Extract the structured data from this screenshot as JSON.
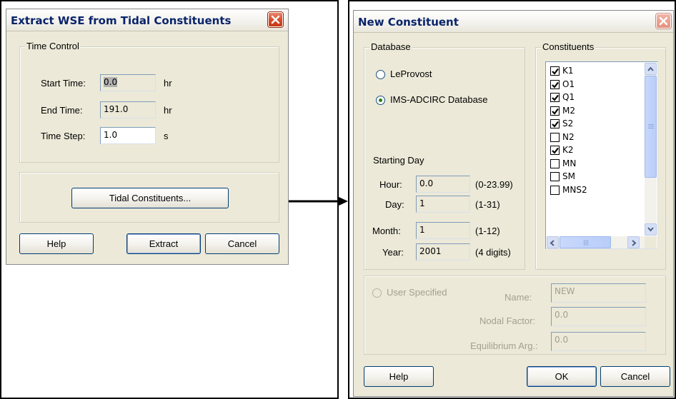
{
  "extract_dialog": {
    "title": "Extract WSE from Tidal Constituents",
    "time_control_legend": "Time Control",
    "start_time_label": "Start Time:",
    "start_time_value": "0.0",
    "start_time_unit": "hr",
    "end_time_label": "End Time:",
    "end_time_value": "191.0",
    "end_time_unit": "hr",
    "time_step_label": "Time Step:",
    "time_step_value": "1.0",
    "time_step_unit": "s",
    "tidal_constituents_button": "Tidal Constituents...",
    "help_button": "Help",
    "extract_button": "Extract",
    "cancel_button": "Cancel"
  },
  "constituent_dialog": {
    "title": "New Constituent",
    "database_legend": "Database",
    "radio_leprovost": "LeProvost",
    "radio_ims": "IMS-ADCIRC Database",
    "selected_database": "IMS-ADCIRC Database",
    "starting_day_label": "Starting Day",
    "hour_label": "Hour:",
    "hour_value": "0.0",
    "hour_range": "(0-23.99)",
    "day_label": "Day:",
    "day_value": "1",
    "day_range": "(1-31)",
    "month_label": "Month:",
    "month_value": "1",
    "month_range": "(1-12)",
    "year_label": "Year:",
    "year_value": "2001",
    "year_range": "(4 digits)",
    "constituents_legend": "Constituents",
    "constituents": [
      {
        "name": "K1",
        "checked": true
      },
      {
        "name": "O1",
        "checked": true
      },
      {
        "name": "Q1",
        "checked": true
      },
      {
        "name": "M2",
        "checked": true
      },
      {
        "name": "S2",
        "checked": true
      },
      {
        "name": "N2",
        "checked": false
      },
      {
        "name": "K2",
        "checked": true
      },
      {
        "name": "MN",
        "checked": false
      },
      {
        "name": "SM",
        "checked": false
      },
      {
        "name": "MNS2",
        "checked": false
      }
    ],
    "user_specified_label": "User Specified",
    "name_label": "Name:",
    "name_value": "NEW",
    "nodal_factor_label": "Nodal Factor:",
    "nodal_factor_value": "0.0",
    "equilibrium_arg_label": "Equilibrium Arg.:",
    "equilibrium_arg_value": "0.0",
    "help_button": "Help",
    "ok_button": "OK",
    "cancel_button": "Cancel"
  },
  "colors": {
    "dialog_bg": "#ece9d8",
    "title_text": "#0a246a",
    "close_button": "#d94a25",
    "checkmark": "#000000",
    "radio_dot": "#2a7d1b",
    "disabled_text": "#a3a08f"
  },
  "icons": {
    "close": "close-x-icon",
    "arrow": "right-arrow-connector",
    "scroll_up": "chevron-up-icon",
    "scroll_down": "chevron-down-icon",
    "scroll_left": "chevron-left-icon",
    "scroll_right": "chevron-right-icon"
  }
}
